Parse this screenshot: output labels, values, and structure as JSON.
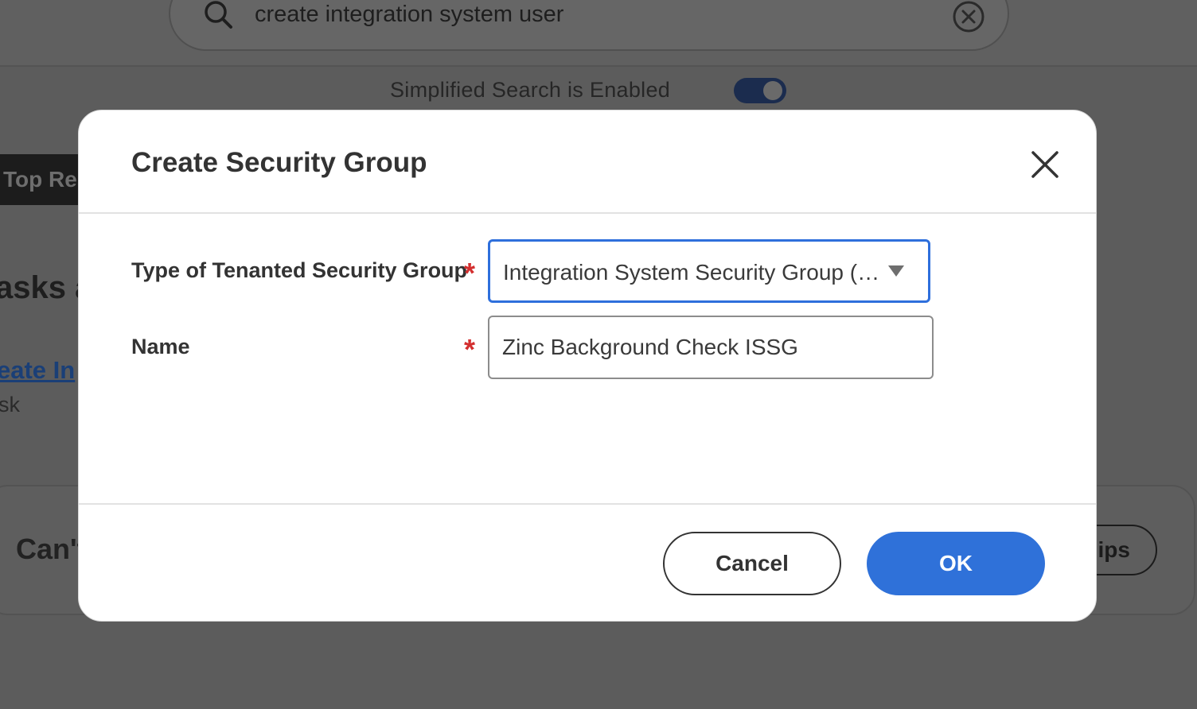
{
  "background": {
    "search": {
      "query": "create integration system user",
      "search_icon": "search-icon",
      "clear_icon": "clear-circle-icon"
    },
    "simplified_search": {
      "label": "Simplified Search is Enabled",
      "enabled": true
    },
    "tabs": {
      "top_results": "Top Res"
    },
    "section_heading": "asks a",
    "task_link": "eate In",
    "task_subtitle": "sk",
    "help_card": {
      "text": "Can't",
      "tips_button": "ips"
    }
  },
  "modal": {
    "title": "Create Security Group",
    "close_icon": "close-icon",
    "fields": {
      "type": {
        "label": "Type of Tenanted Security Group",
        "required_marker": "*",
        "value": "Integration System Security Group (Unconstrained)"
      },
      "name": {
        "label": "Name",
        "required_marker": "*",
        "value": "Zinc Background Check ISSG"
      }
    },
    "buttons": {
      "cancel": "Cancel",
      "ok": "OK"
    }
  },
  "colors": {
    "primary": "#2f71d9",
    "required": "#d32f2f",
    "focus_border": "#2e6fdc",
    "overlay": "#5c5c5c"
  }
}
